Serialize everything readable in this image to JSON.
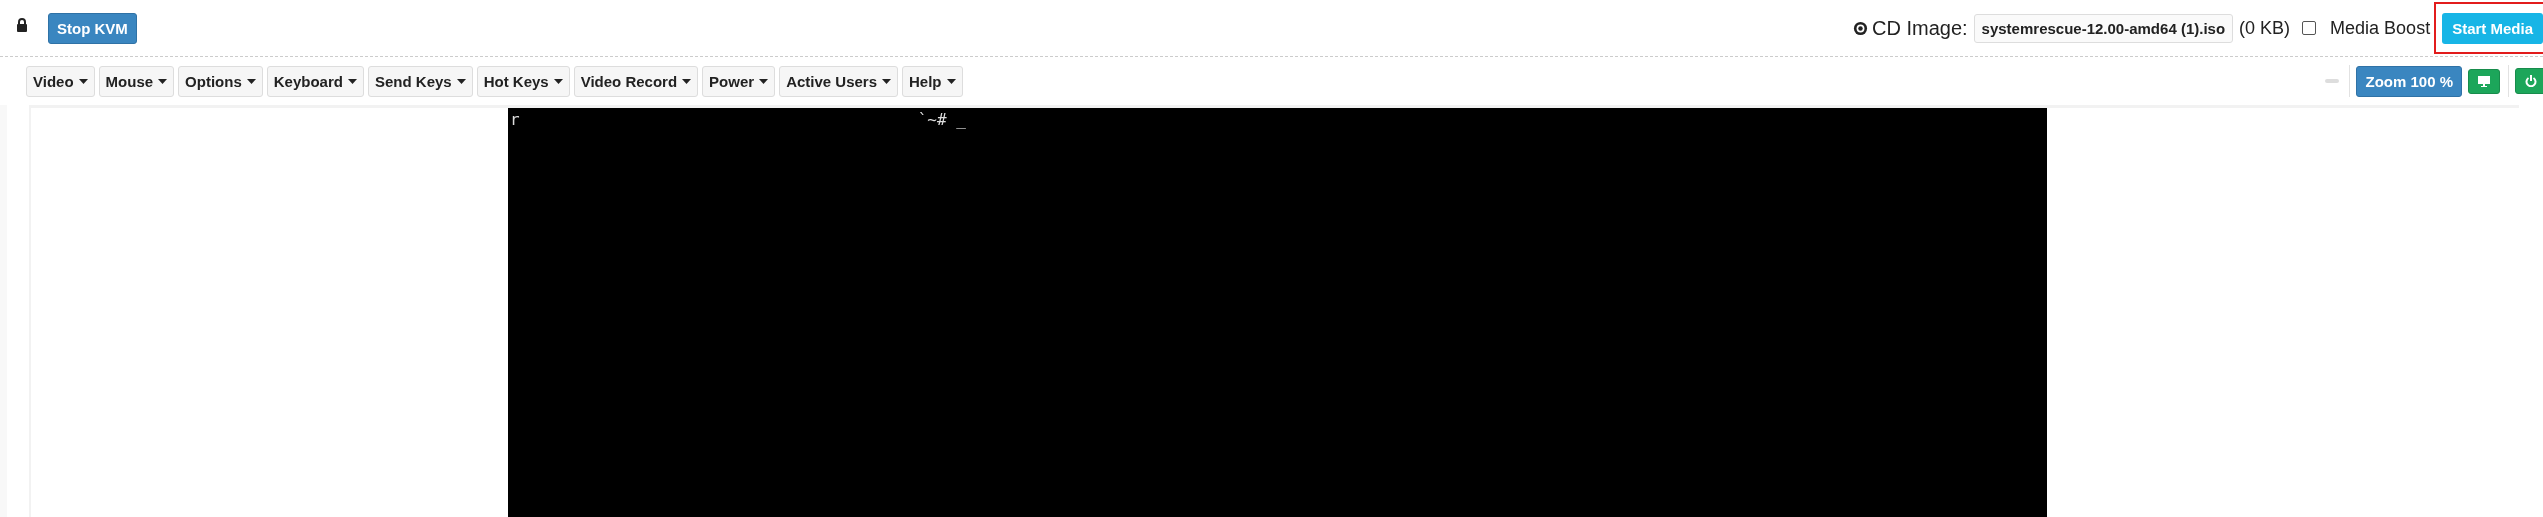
{
  "header": {
    "locked": true,
    "stop_button": "Stop KVM",
    "cd_label": "CD Image:",
    "cd_file": "systemrescue-12.00-amd64 (1).iso",
    "cd_size": "(0 KB)",
    "media_boost": {
      "label": "Media Boost",
      "checked": false
    },
    "start_button": {
      "label": "Start Media",
      "highlighted": true
    }
  },
  "menus": [
    {
      "label": "Video"
    },
    {
      "label": "Mouse"
    },
    {
      "label": "Options"
    },
    {
      "label": "Keyboard"
    },
    {
      "label": "Send Keys"
    },
    {
      "label": "Hot Keys"
    },
    {
      "label": "Video Record"
    },
    {
      "label": "Power"
    },
    {
      "label": "Active Users"
    },
    {
      "label": "Help"
    }
  ],
  "zoom_button": "Zoom 100 %",
  "terminal": {
    "lines": [
      {
        "left": "r",
        "right": "`~# _"
      }
    ]
  }
}
